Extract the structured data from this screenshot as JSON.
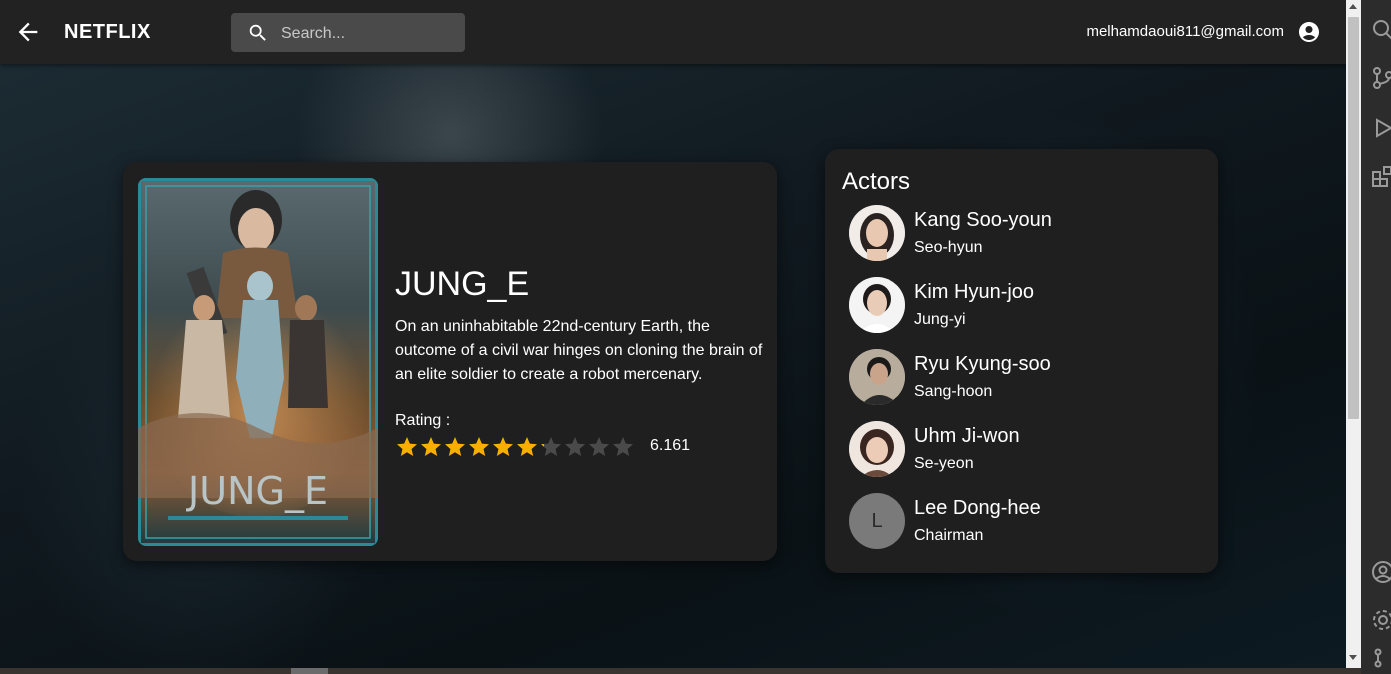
{
  "app": {
    "brand": "NETFLIX",
    "user_email": "melhamdaoui811@gmail.com"
  },
  "search": {
    "placeholder": "Search..."
  },
  "movie": {
    "title": "JUNG_E",
    "overview": "On an uninhabitable 22nd-century Earth, the outcome of a civil war hinges on cloning the brain of an elite soldier to create a robot mercenary.",
    "rating_label": "Rating :",
    "rating_value": "6.161",
    "rating_fraction": 0.6161,
    "rating_stars_total": 10,
    "poster_text": "JUNG_E"
  },
  "actors": {
    "title": "Actors",
    "items": [
      {
        "name": "Kang Soo-youn",
        "role": "Seo-hyun"
      },
      {
        "name": "Kim Hyun-joo",
        "role": "Jung-yi"
      },
      {
        "name": "Ryu Kyung-soo",
        "role": "Sang-hoon"
      },
      {
        "name": "Uhm Ji-won",
        "role": "Se-yeon"
      },
      {
        "name": "Lee Dong-hee",
        "role": "Chairman",
        "avatar_letter": "L"
      }
    ]
  },
  "colors": {
    "appbar": "#222222",
    "card": "#1f1f1f",
    "star_filled": "#faaf00",
    "star_empty": "#4a4a4a",
    "search_bg": "#4a4a4a"
  },
  "icons": {
    "back": "arrow-left-icon",
    "search": "search-icon",
    "account": "account-circle-icon",
    "star": "star-icon"
  }
}
